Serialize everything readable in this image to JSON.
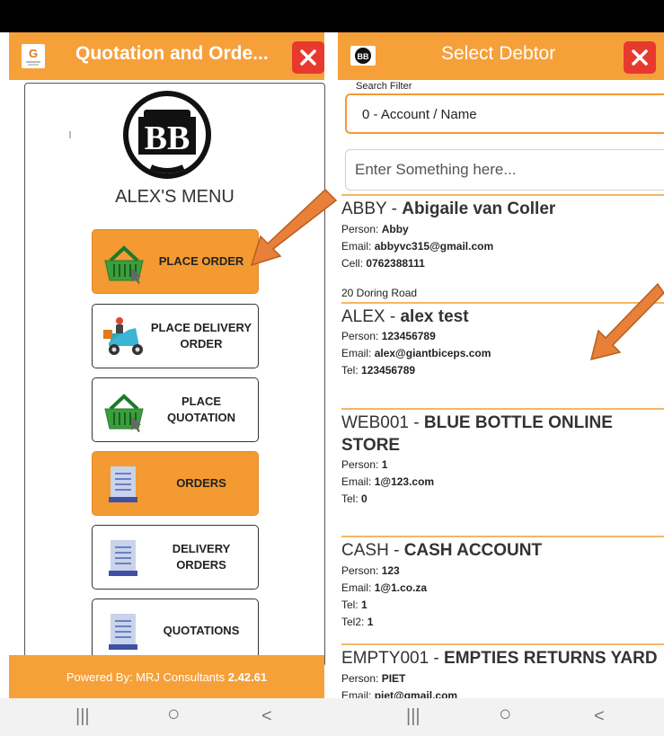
{
  "left_app": {
    "title": "Quotation and Orde...",
    "menu_title": "ALEX'S MENU",
    "logo_text": "BB",
    "buttons": [
      {
        "label": "PLACE ORDER",
        "icon": "basket-icon",
        "active": true
      },
      {
        "label": "PLACE DELIVERY ORDER",
        "icon": "delivery-scooter-icon",
        "active": false
      },
      {
        "label": "PLACE QUOTATION",
        "icon": "basket-icon",
        "active": false
      },
      {
        "label": "ORDERS",
        "icon": "document-icon",
        "active": true
      },
      {
        "label": "DELIVERY ORDERS",
        "icon": "document-icon",
        "active": false
      },
      {
        "label": "QUOTATIONS",
        "icon": "document-icon",
        "active": false
      }
    ],
    "footer_prefix": "Powered By: MRJ Consultants ",
    "footer_version": "2.42.61"
  },
  "right_app": {
    "title": "Select Debtor",
    "filter_label": "Search Filter",
    "filter_value": "0 - Account / Name",
    "search_placeholder": "Enter Something here...",
    "debtors": [
      {
        "code": "ABBY - ",
        "name": "Abigaile van Coller",
        "lines": [
          [
            "Person: ",
            "Abby"
          ],
          [
            "Email: ",
            "abbyvc315@gmail.com"
          ],
          [
            "Cell: ",
            "0762388111"
          ]
        ],
        "address": "20 Doring Road"
      },
      {
        "code": "ALEX - ",
        "name": "alex test",
        "lines": [
          [
            "Person: ",
            "123456789"
          ],
          [
            "Email: ",
            "alex@giantbiceps.com"
          ],
          [
            "Tel: ",
            "123456789"
          ]
        ]
      },
      {
        "code": "WEB001 - ",
        "name": "BLUE BOTTLE ONLINE",
        "name2": "STORE",
        "lines": [
          [
            "Person: ",
            "1"
          ],
          [
            "Email: ",
            "1@123.com"
          ],
          [
            "Tel: ",
            "0"
          ]
        ]
      },
      {
        "code": "CASH - ",
        "name": "CASH ACCOUNT",
        "lines": [
          [
            "Person: ",
            "123"
          ],
          [
            "Email: ",
            "1@1.co.za"
          ],
          [
            "Tel: ",
            "1"
          ],
          [
            "Tel2: ",
            "1"
          ]
        ]
      },
      {
        "code": "EMPTY001 - ",
        "name": "EMPTIES RETURNS YARD",
        "lines": [
          [
            "Person: ",
            "PIET"
          ],
          [
            "Email: ",
            "piet@gmail.com"
          ]
        ]
      }
    ]
  },
  "nav": {
    "recents": "|||",
    "home": "○",
    "back": "<"
  },
  "colors": {
    "accent": "#f6a03a",
    "close": "#e8392f",
    "arrow": "#e8803a"
  }
}
